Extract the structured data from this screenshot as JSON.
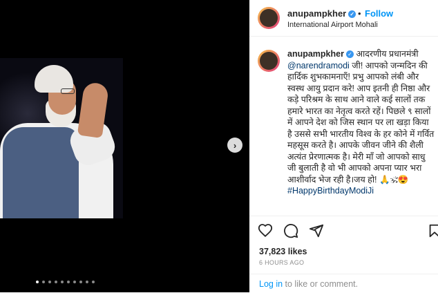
{
  "media": {
    "next_icon": "chevron-right-icon",
    "next_glyph": "›",
    "carousel_count": 10,
    "carousel_active": 1
  },
  "post_header": {
    "username": "anupampkher",
    "separator": "•",
    "follow_label": "Follow",
    "location": "International Airport Mohali"
  },
  "caption": {
    "username": "anupampkher",
    "text_1": " आदरणीय प्रधानमंत्री ",
    "mention": "@narendramodi",
    "text_2": " जी! आपको जन्मदिन की हार्दिक शुभकामनाएँ! प्रभु आपको लंबी और स्वस्थ आयु प्रदान करे! आप इतनी ही निष्ठा और कड़े परिश्रम के साथ आने वाले कई सालों तक हमारे भारत का नेतृत्व करते रहें। पिछले ९ सालों में आपने देश को जिस स्थान पर ला खड़ा किया है उससे सभी भारतीय विश्व के हर कोने में गर्वित महसूस करते है। आपके जीवन जीने की शैली अत्यंत प्रेरणात्मक है। मेरी माँ जो आपको साधु जी बुलाती है वो भी आपको अपना प्यार भरा आशीर्वाद भेज रही है।जय हो! 🙏🕉😍",
    "hashtag": "#HappyBirthdayModiJi"
  },
  "actions": {
    "like_icon": "heart-icon",
    "comment_icon": "comment-icon",
    "share_icon": "share-icon",
    "save_icon": "bookmark-icon"
  },
  "stats": {
    "likes": "37,823 likes",
    "time": "6 HOURS AGO"
  },
  "footer": {
    "login_link": "Log in",
    "login_suffix": " to like or comment."
  },
  "colors": {
    "link_blue": "#0095f6",
    "mention_blue": "#00376b",
    "media_bg": "#000000"
  }
}
